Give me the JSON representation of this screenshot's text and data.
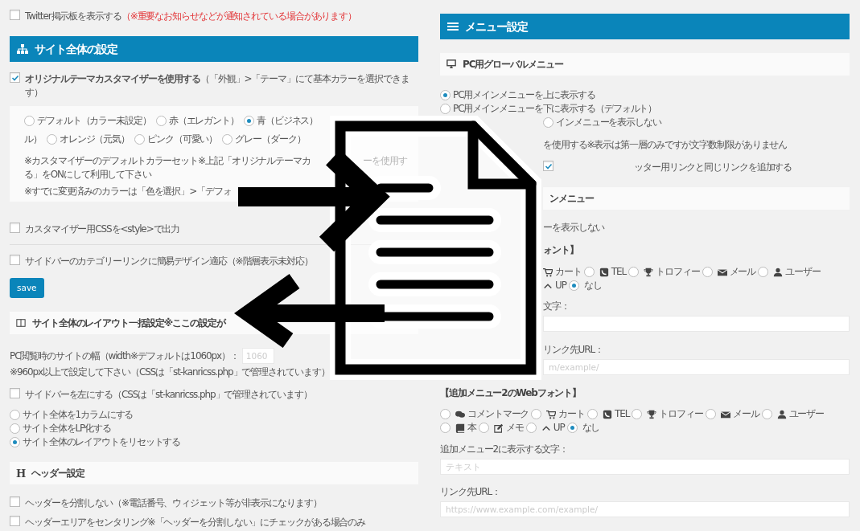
{
  "left": [
    {
      "kind": "checkbox",
      "checked": false,
      "text": "Twitter掲示板を表示する",
      "note": "（※重要なお知らせなどが通知されている場合があります）"
    },
    {
      "kind": "header",
      "title": "サイト全体の設定"
    },
    {
      "kind": "checkbox",
      "checked": true,
      "text": "**オリジナルテーマカスタマイザーを使用する**（「外観」>「テーマ」にて基本カラーを選択できます）"
    },
    {
      "kind": "colorbox",
      "options": [
        {
          "kind": "radio",
          "label": "デフォルト（カラー未設定）",
          "selected": false
        },
        {
          "kind": "radio",
          "label": "赤（エレガント）",
          "selected": false
        },
        {
          "kind": "radio",
          "label": "青（ビジネス）",
          "selected": true
        },
        {
          "kind": "fragment",
          "label": "ル）"
        },
        {
          "kind": "radio",
          "label": "オレンジ（元気）",
          "selected": false
        },
        {
          "kind": "radio",
          "label": "ピンク（可愛い）",
          "selected": false
        },
        {
          "kind": "radio",
          "label": "グレー（ダーク）",
          "selected": false
        }
      ],
      "notes": [
        [
          "※カスタマイザーのデフォルトカラーセット※上記「オリジナルテーマカ",
          "ーを使用す"
        ],
        [
          "る」をONにして利用して下さい"
        ],
        [
          "※すでに変更済みのカラーは「色を選択」>「デフォ"
        ]
      ]
    },
    {
      "kind": "checkbox",
      "checked": false,
      "text": "カスタマイザー用CSSを<style>で出力"
    },
    {
      "kind": "checkbox",
      "checked": false,
      "text": "サイドバーのカテゴリーリンクに簡易デザイン適応（※階層表示未対応）"
    },
    {
      "kind": "button",
      "label": "save"
    },
    {
      "kind": "panel",
      "title": "サイト全体のレイアウト一括設定※ここの設定が"
    },
    {
      "kind": "field",
      "label": "PC閲覧時のサイトの幅（width※デフォルトは1060px）：",
      "value": "1060"
    },
    {
      "kind": "text",
      "text": "※960px以上で設定して下さい（CSSは「st-kanricss.php」で管理されています）"
    },
    {
      "kind": "checkbox",
      "checked": false,
      "text": "サイドバーを左にする（CSSは「st-kanricss.php」で管理されています）"
    },
    {
      "kind": "radios",
      "options": [
        {
          "label": "サイト全体を1カラムにする",
          "selected": false
        },
        {
          "label": "サイト全体をLP化する",
          "selected": false
        },
        {
          "label": "サイト全体のレイアウトをリセットする",
          "selected": true
        }
      ]
    },
    {
      "kind": "panel",
      "glyph": "H",
      "title": "ヘッダー設定"
    },
    {
      "kind": "checkbox",
      "checked": false,
      "text": "ヘッダーを分割しない（※電話番号、ウィジェット等が非表示になります）"
    },
    {
      "kind": "checkbox",
      "checked": false,
      "text": "ヘッダーエリアをセンタリング※「ヘッダーを分割しない」にチェックがある場合のみ"
    }
  ],
  "right": [
    {
      "kind": "header",
      "title": "メニュー設定"
    },
    {
      "kind": "panel",
      "title": "PC用グローバルメニュー"
    },
    {
      "kind": "radios",
      "options": [
        {
          "label": "PC用メインメニューを上に表示する",
          "selected": true
        },
        {
          "label": "PC用メインメニューを下に表示する（デフォルト）",
          "selected": false
        },
        {
          "label": "インメニューを表示しない",
          "selected": false,
          "obscured": true
        }
      ]
    },
    {
      "kind": "text",
      "text": "を使用する※表示は第一層のみですが文字数制限がありません",
      "obscured": true
    },
    {
      "kind": "checkbox",
      "checked": true,
      "text": "ッター用リンクと同じリンクを追加する",
      "obscured": true
    },
    {
      "kind": "panel",
      "title": "ンメニュー",
      "obscured": true
    },
    {
      "kind": "text",
      "text": "ーを表示しない",
      "obscured": true
    },
    {
      "kind": "bold",
      "text": "ォント】",
      "obscured": true
    },
    {
      "kind": "iconradios",
      "obscured": true,
      "lines": [
        [
          {
            "kind": "cart",
            "label": "カート"
          },
          {
            "kind": "phone",
            "label": "TEL",
            "selected": false
          },
          {
            "kind": "trophy",
            "label": "トロフィー",
            "selected": false
          },
          {
            "kind": "mail",
            "label": "メール",
            "selected": false
          },
          {
            "kind": "user",
            "label": "ユーザー",
            "selected": false
          }
        ],
        [
          {
            "kind": "chevron",
            "label": "UP"
          },
          {
            "kind": "plain",
            "label": "なし",
            "selected": true
          }
        ]
      ]
    },
    {
      "kind": "field",
      "label": "文字：",
      "obscured": true
    },
    {
      "kind": "field",
      "label": "リンク先URL：",
      "placeholder": "m/example/",
      "obscured": true
    },
    {
      "kind": "bold",
      "text": "【追加メニュー2のWebフォント】"
    },
    {
      "kind": "iconradios",
      "lines": [
        [
          {
            "kind": "comment",
            "label": "コメントマーク",
            "selected": false
          },
          {
            "kind": "cart",
            "label": "カート",
            "selected": false
          },
          {
            "kind": "phone",
            "label": "TEL",
            "selected": false
          },
          {
            "kind": "trophy",
            "label": "トロフィー",
            "selected": false
          },
          {
            "kind": "mail",
            "label": "メール",
            "selected": false
          },
          {
            "kind": "user",
            "label": "ユーザー",
            "selected": false
          }
        ],
        [
          {
            "kind": "book",
            "label": "本",
            "selected": false
          },
          {
            "kind": "memo",
            "label": "メモ",
            "selected": false
          },
          {
            "kind": "chevron",
            "label": "UP",
            "selected": false
          },
          {
            "kind": "plain",
            "label": "なし",
            "selected": true
          }
        ]
      ]
    },
    {
      "kind": "field",
      "label": "追加メニュー2に表示する文字：",
      "placeholder": "テキスト"
    },
    {
      "kind": "field",
      "label": "リンク先URL：",
      "placeholder": "https://www.example.com/example/"
    }
  ]
}
